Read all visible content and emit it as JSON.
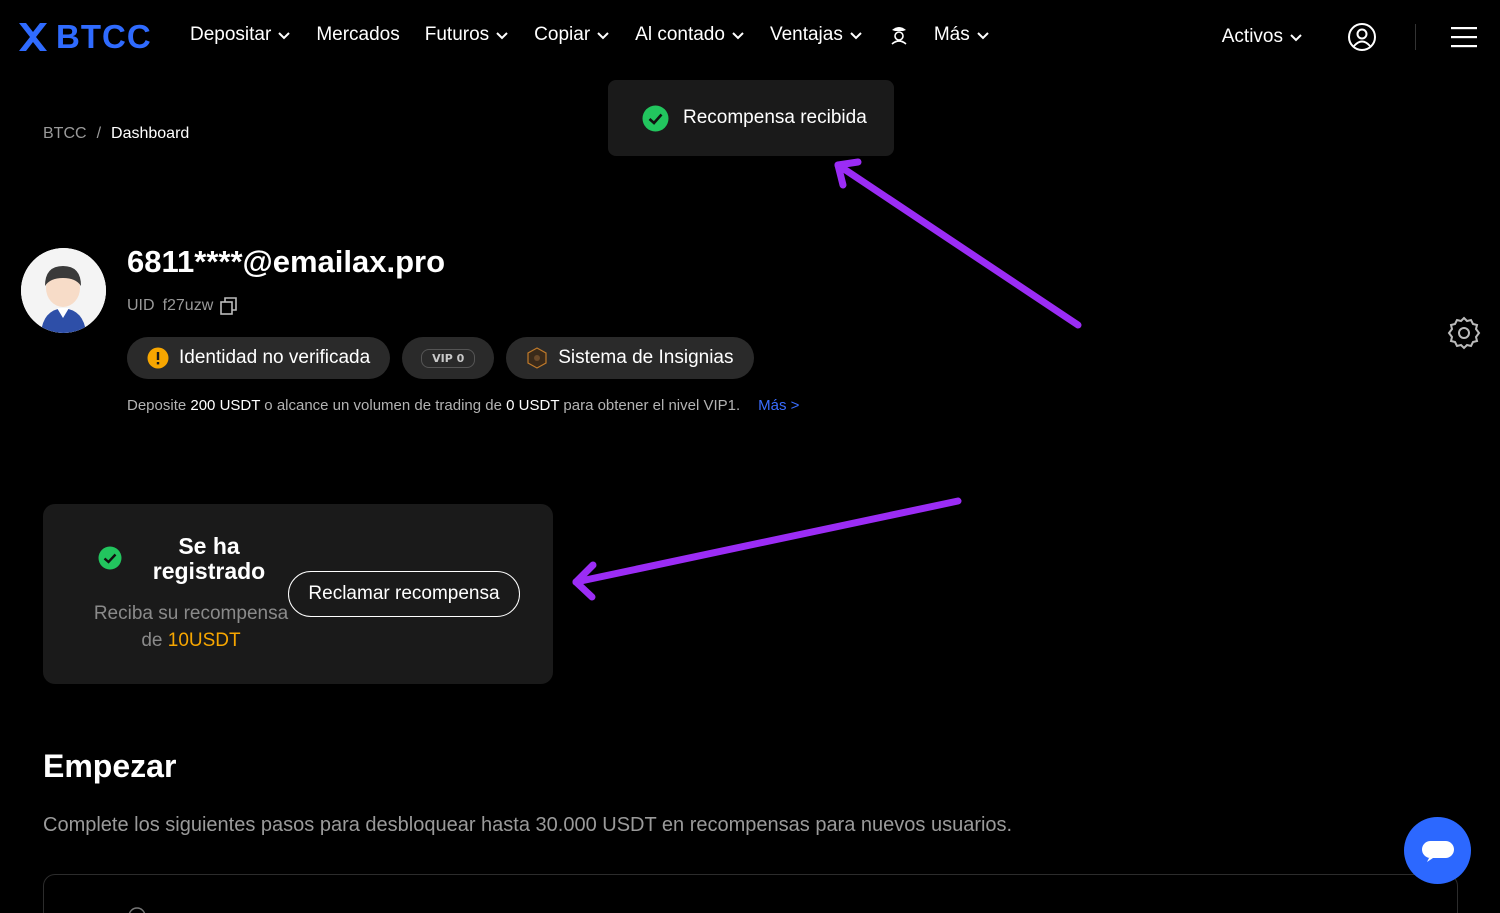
{
  "nav": {
    "logo_text": "BTCC",
    "menu": [
      {
        "label": "Depositar",
        "dropdown": true
      },
      {
        "label": "Mercados",
        "dropdown": false
      },
      {
        "label": "Futuros",
        "dropdown": true
      },
      {
        "label": "Copiar",
        "dropdown": true
      },
      {
        "label": "Al contado",
        "dropdown": true
      },
      {
        "label": "Ventajas",
        "dropdown": true
      },
      {
        "label": "Más",
        "dropdown": true
      }
    ],
    "activos_label": "Activos"
  },
  "toast": {
    "text": "Recompensa recibida"
  },
  "breadcrumb": {
    "root": "BTCC",
    "separator": "/",
    "current": "Dashboard"
  },
  "profile": {
    "email": "6811****@emailax.pro",
    "uid_label": "UID",
    "uid_value": "f27uzw",
    "identity_label": "Identidad no verificada",
    "vip_label": "VIP 0",
    "badges_label": "Sistema de Insignias",
    "note": {
      "p1": "Deposite ",
      "amount1": "200 USDT",
      "p2": " o alcance un volumen de trading de ",
      "amount2": "0 USDT",
      "p3": " para obtener el nivel VIP1.",
      "link": "Más >"
    }
  },
  "reward_card": {
    "title": "Se ha registrado",
    "desc": "Reciba su recompensa de ",
    "amount": "10USDT",
    "button": "Reclamar recompensa"
  },
  "start": {
    "title": "Empezar",
    "subtitle": "Complete los siguientes pasos para desbloquear hasta 30.000 USDT en recompensas para nuevos usuarios."
  },
  "colors": {
    "brand": "#2f6bff",
    "success": "#22c55e",
    "warning": "#f7a600",
    "annotation": "#9b2cf5",
    "link": "#3a6dff"
  }
}
